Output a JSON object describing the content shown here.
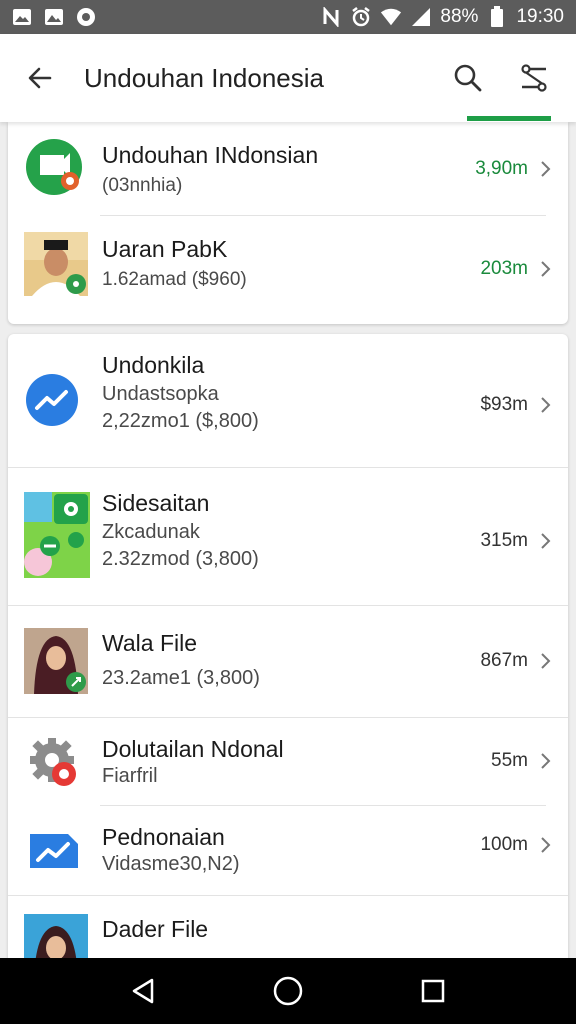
{
  "status_bar": {
    "battery": "88%",
    "time": "19:30",
    "left_icons": [
      "image-icon",
      "image-icon",
      "circle-app-icon"
    ],
    "right_icons": [
      "nfc-icon",
      "alarm-icon",
      "wifi-icon",
      "signal-icon",
      "battery-icon"
    ]
  },
  "app_bar": {
    "title": "Undouhan Indonesia",
    "back_icon": "arrow-left-icon",
    "search_icon": "search-icon",
    "filter_icon": "filter-icon",
    "accent": "#1e9e47"
  },
  "list1": [
    {
      "title": "Undouhan INdonsian",
      "subtitle": "(03nnhia)",
      "size": "3,90m",
      "size_color": "green",
      "thumb": "chat-app-icon"
    },
    {
      "title": "Uaran PabK",
      "subtitle": "1.62amad ($960)",
      "size": "203m",
      "size_color": "green",
      "thumb": "man-photo-thumbnail"
    }
  ],
  "list2": [
    {
      "title": "Undonkila",
      "subtitle": "Undastsopka",
      "detail": "2,22zmo1 ($,800)",
      "size": "$93m",
      "thumb": "trend-circle-icon"
    },
    {
      "title": "Sidesaitan",
      "subtitle": "Zkcadunak",
      "detail": "2.32zmod (3,800)",
      "size": "315m",
      "thumb": "green-app-thumbnail"
    },
    {
      "title": "Wala File",
      "subtitle": "",
      "detail": "23.2ame1 (3,800)",
      "size": "867m",
      "thumb": "woman-photo-thumbnail"
    },
    {
      "title": "Dolutailan Ndonal",
      "subtitle": "Fiarfril",
      "detail": "",
      "size": "55m",
      "thumb": "gear-record-icon"
    },
    {
      "title": "Pednonaian",
      "subtitle": "Vidasme30,N2)",
      "detail": "",
      "size": "100m",
      "thumb": "chart-folder-icon"
    },
    {
      "title": "Dader File",
      "subtitle": "",
      "detail": "",
      "size": "",
      "thumb": "woman-photo-thumbnail"
    }
  ],
  "nav_bar": {
    "buttons": [
      "back-triangle-icon",
      "home-circle-icon",
      "recents-square-icon"
    ]
  }
}
